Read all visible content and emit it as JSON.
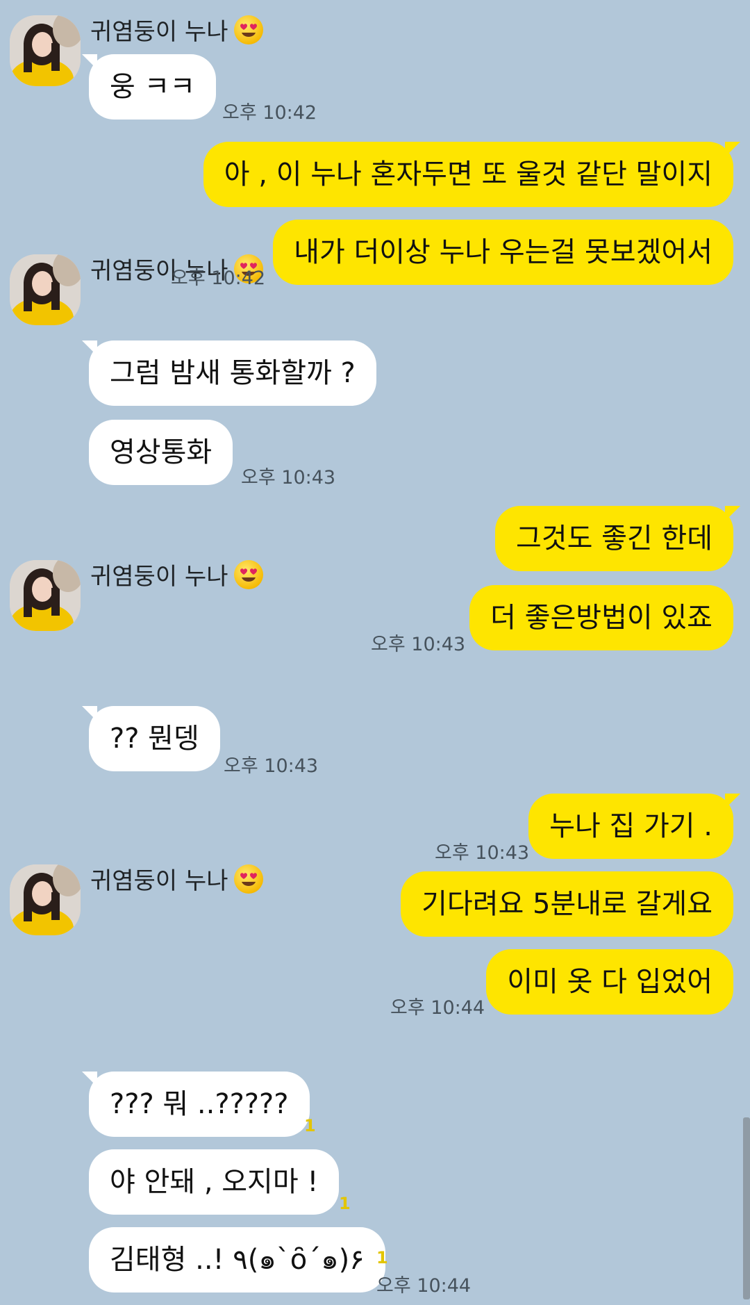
{
  "contact": {
    "name": "귀염둥이 누나"
  },
  "colors": {
    "background": "#b2c7d9",
    "incoming_bubble": "#ffffff",
    "outgoing_bubble": "#fee500",
    "unread_count": "#e3c500"
  },
  "messages": [
    {
      "id": "m1",
      "dir": "in",
      "text": "웅 ㅋㅋ",
      "time": "오후 10:42"
    },
    {
      "id": "m2",
      "dir": "out",
      "text": "아 , 이 누나 혼자두면 또 울것 같단 말이지"
    },
    {
      "id": "m3",
      "dir": "out",
      "text": "내가 더이상 누나 우는걸 못보겠어서",
      "time": "오후 10:42"
    },
    {
      "id": "m4",
      "dir": "in",
      "text": "그럼 밤새 통화할까 ?"
    },
    {
      "id": "m5",
      "dir": "in",
      "text": "영상통화",
      "time": "오후 10:43"
    },
    {
      "id": "m6",
      "dir": "out",
      "text": "그것도 좋긴 한데"
    },
    {
      "id": "m7",
      "dir": "out",
      "text": "더 좋은방법이 있죠",
      "time": "오후 10:43"
    },
    {
      "id": "m8",
      "dir": "in",
      "text": "?? 뭔뎅",
      "time": "오후 10:43"
    },
    {
      "id": "m9",
      "dir": "out",
      "text": "누나 집 가기 .",
      "time": "오후 10:43"
    },
    {
      "id": "m10",
      "dir": "out",
      "text": "기다려요 5분내로 갈게요"
    },
    {
      "id": "m11",
      "dir": "out",
      "text": "이미 옷 다 입었어",
      "time": "오후 10:44"
    },
    {
      "id": "m12",
      "dir": "in",
      "text": "??? 뭐 ..?????",
      "unread": "1"
    },
    {
      "id": "m13",
      "dir": "in",
      "text": "야 안돼 , 오지마 !",
      "unread": "1"
    },
    {
      "id": "m14",
      "dir": "in",
      "text": "김태형 ..! ٩(๑`ȏ´๑)۶",
      "unread": "1",
      "time": "오후 10:44"
    }
  ],
  "icons": {
    "avatar": "profile-photo-icon",
    "emoji": "heart-eyes-emoji-icon"
  }
}
